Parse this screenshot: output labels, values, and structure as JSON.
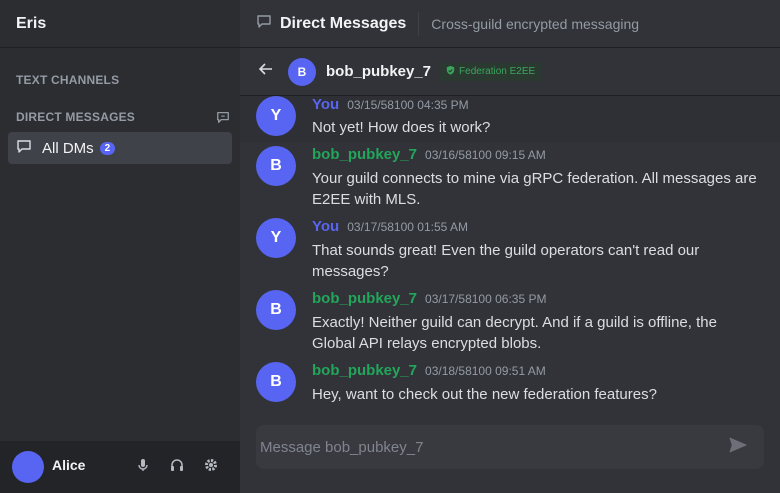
{
  "sidebar": {
    "server_name": "Eris",
    "text_channels_label": "TEXT CHANNELS",
    "direct_messages_label": "DIRECT MESSAGES",
    "dm_item": {
      "label": "All DMs",
      "badge": "2"
    }
  },
  "user_panel": {
    "username": "Alice"
  },
  "header": {
    "title": "Direct Messages",
    "subtitle": "Cross-guild encrypted messaging"
  },
  "conversation": {
    "avatar_letter": "B",
    "name": "bob_pubkey_7",
    "badge": "Federation E2EE"
  },
  "messages": [
    {
      "avatar": "Y",
      "author": "You",
      "time": "03/15/58100 04:35 PM",
      "text": "Not yet! How does it work?",
      "self": true
    },
    {
      "avatar": "B",
      "author": "bob_pubkey_7",
      "time": "03/16/58100 09:15 AM",
      "text": "Your guild connects to mine via gRPC federation. All messages are E2EE with MLS.",
      "self": false
    },
    {
      "avatar": "Y",
      "author": "You",
      "time": "03/17/58100 01:55 AM",
      "text": "That sounds great! Even the guild operators can't read our messages?",
      "self": true
    },
    {
      "avatar": "B",
      "author": "bob_pubkey_7",
      "time": "03/17/58100 06:35 PM",
      "text": "Exactly! Neither guild can decrypt. And if a guild is offline, the Global API relays encrypted blobs.",
      "self": false
    },
    {
      "avatar": "B",
      "author": "bob_pubkey_7",
      "time": "03/18/58100 09:51 AM",
      "text": "Hey, want to check out the new federation features?",
      "self": false
    }
  ],
  "composer": {
    "placeholder": "Message bob_pubkey_7"
  },
  "colors": {
    "accent": "#5865f2",
    "bob": "#23a55a",
    "you": "#5865f2"
  }
}
